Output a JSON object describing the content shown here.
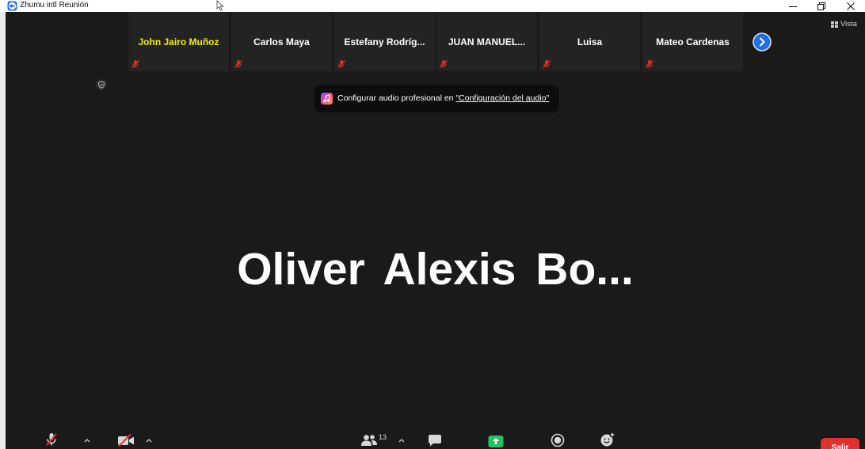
{
  "window": {
    "title": "Zhumu intl Reunión",
    "app_icon": "zhumu-camera-icon",
    "controls": [
      "minimize-icon",
      "restore-icon",
      "close-icon"
    ],
    "pointer": "mouse-pointer-icon"
  },
  "view_menu": {
    "icon": "grid-icon",
    "label": "Vista"
  },
  "encryption": {
    "icon": "shield-check-icon"
  },
  "gallery_strip": {
    "tiles": [
      {
        "name": "John Jairo Muñoz",
        "active_speaker": true,
        "mic": "mic-muted-icon"
      },
      {
        "name": "Carlos Maya",
        "active_speaker": false,
        "mic": "mic-muted-icon"
      },
      {
        "name": "Estefany Rodríg...",
        "active_speaker": false,
        "mic": "mic-muted-icon"
      },
      {
        "name": "JUAN MANUEL...",
        "active_speaker": false,
        "mic": "mic-muted-icon"
      },
      {
        "name": "Luisa",
        "active_speaker": false,
        "mic": "mic-muted-icon"
      },
      {
        "name": "Mateo Cardenas",
        "active_speaker": false,
        "mic": "mic-muted-icon"
      }
    ],
    "next_page_icon": "chevron-right-icon"
  },
  "notification": {
    "icon": "music-note-icon",
    "text": "Configurar audio profesional en ",
    "link": "\"Configuración del audio\""
  },
  "main_video": {
    "name": "Oliver Alexis Bo..."
  },
  "toolbar": {
    "audio": {
      "icon": "mic-muted-icon",
      "muted": true
    },
    "video": {
      "icon": "video-off-icon",
      "off": true
    },
    "participants": {
      "icon": "participants-icon",
      "count": "13"
    },
    "chat": {
      "icon": "chat-icon"
    },
    "share": {
      "icon": "share-screen-icon"
    },
    "record": {
      "icon": "record-icon"
    },
    "reactions": {
      "icon": "reactions-icon"
    },
    "leave": {
      "label": "Salir"
    }
  },
  "colors": {
    "background": "#1a1a1a",
    "tile": "#232323",
    "active_speaker_name": "#f0f000",
    "muted": "#e5332a",
    "accent_blue": "#1f6fe0",
    "share_green": "#22c35e",
    "leave_red": "#e0302f",
    "notification_bg": "#0d0d0d"
  }
}
